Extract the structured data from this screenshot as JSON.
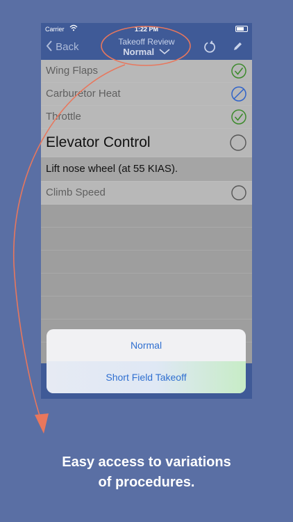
{
  "status_bar": {
    "carrier": "Carrier",
    "time": "1:22 PM"
  },
  "nav": {
    "back_label": "Back",
    "title": "Takeoff Review",
    "subtitle": "Normal"
  },
  "icons": {
    "back": "chevron-left-icon",
    "dropdown": "chevron-down-icon",
    "reset": "reset-icon",
    "edit": "pencil-icon",
    "checked": "check-circle-icon",
    "skipped": "slash-circle-icon",
    "unchecked": "empty-circle-icon"
  },
  "checklist": {
    "items": [
      {
        "label": "Wing Flaps",
        "status": "checked"
      },
      {
        "label": "Carburetor Heat",
        "status": "skipped"
      },
      {
        "label": "Throttle",
        "status": "checked"
      },
      {
        "label": "Elevator Control",
        "status": "unchecked",
        "current": true
      },
      {
        "label": "Lift nose wheel (at 55 KIAS).",
        "status": "instruction"
      },
      {
        "label": "Climb Speed",
        "status": "unchecked"
      }
    ]
  },
  "sheet": {
    "options": [
      "Normal",
      "Short Field Takeoff"
    ]
  },
  "caption": {
    "line1": "Easy access to variations",
    "line2": "of procedures."
  },
  "colors": {
    "background": "#5a6fa4",
    "nav": "#3f5a97",
    "check_green": "#3c8a2c",
    "skip_blue": "#2f63c9",
    "annotation": "#e8775d",
    "sheet_text": "#2f6fd0"
  }
}
